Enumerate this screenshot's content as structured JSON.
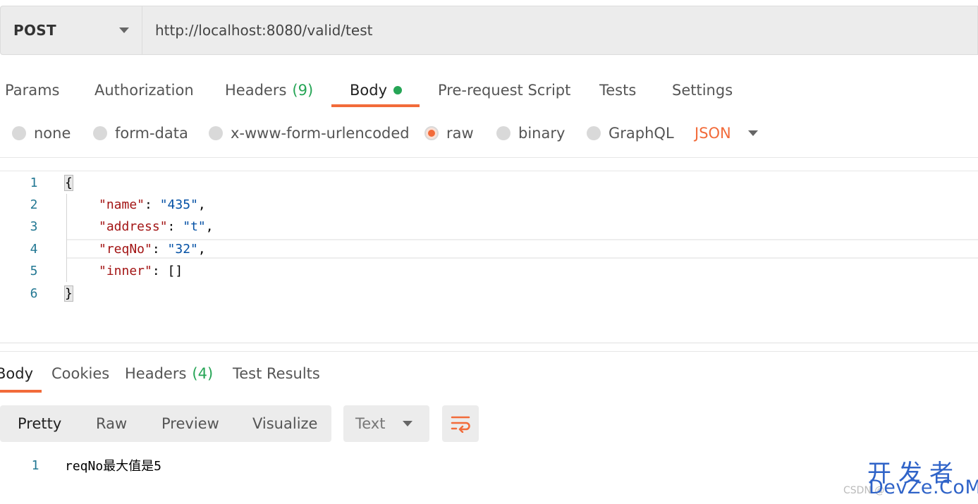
{
  "request": {
    "method": "POST",
    "url": "http://localhost:8080/valid/test"
  },
  "request_tabs": [
    {
      "label": "Params"
    },
    {
      "label": "Authorization"
    },
    {
      "label": "Headers",
      "count": "(9)"
    },
    {
      "label": "Body",
      "active": true
    },
    {
      "label": "Pre-request Script"
    },
    {
      "label": "Tests"
    },
    {
      "label": "Settings"
    }
  ],
  "body_types": [
    {
      "label": "none",
      "selected": false
    },
    {
      "label": "form-data",
      "selected": false
    },
    {
      "label": "x-www-form-urlencoded",
      "selected": false
    },
    {
      "label": "raw",
      "selected": true
    },
    {
      "label": "binary",
      "selected": false
    },
    {
      "label": "GraphQL",
      "selected": false
    }
  ],
  "raw_format": "JSON",
  "editor": {
    "lines": [
      {
        "n": "1",
        "open": "{"
      },
      {
        "n": "2",
        "key": "\"name\"",
        "sep": ": ",
        "val": "\"435\"",
        "end": ","
      },
      {
        "n": "3",
        "key": "\"address\"",
        "sep": ": ",
        "val": "\"t\"",
        "end": ","
      },
      {
        "n": "4",
        "key": "\"reqNo\"",
        "sep": ": ",
        "val": "\"32\"",
        "end": ","
      },
      {
        "n": "5",
        "key": "\"inner\"",
        "sep": ": ",
        "val": "[]",
        "end": ""
      },
      {
        "n": "6",
        "close": "}"
      }
    ]
  },
  "response_tabs": [
    {
      "label": "Body",
      "active": true
    },
    {
      "label": "Cookies"
    },
    {
      "label": "Headers",
      "count": "(4)"
    },
    {
      "label": "Test Results"
    }
  ],
  "response_views": [
    "Pretty",
    "Raw",
    "Preview",
    "Visualize"
  ],
  "response_format": "Text",
  "response_body": {
    "line_number": "1",
    "text": "reqNo最大值是5"
  },
  "watermark": {
    "top": "开发者",
    "bottom": "DevZe.CoM",
    "csdn": "CSDN @"
  },
  "colors": {
    "accent": "#f26b3a",
    "green": "#26a556",
    "json_key": "#a31515",
    "json_string": "#0451a5",
    "line_number": "#237893",
    "watermark": "#2f63c8"
  },
  "icons": {
    "method_dropdown": "chevron-down-icon",
    "wrap": "wrap-lines-icon"
  }
}
